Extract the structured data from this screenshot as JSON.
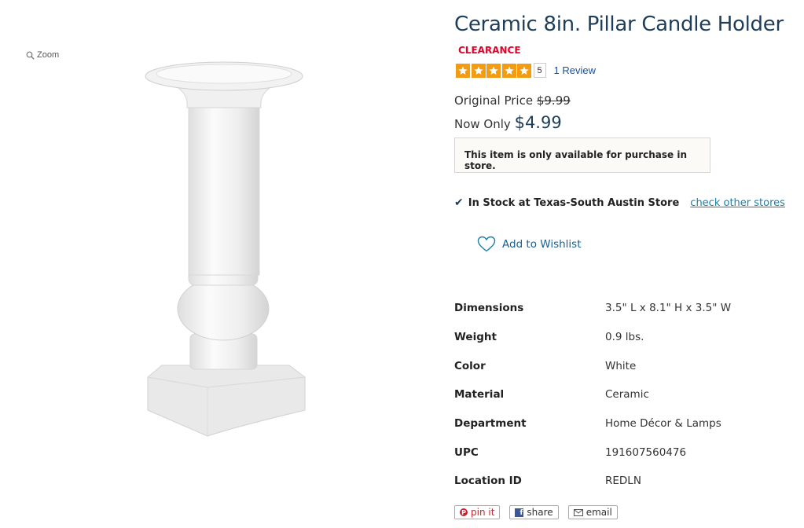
{
  "gallery": {
    "zoom_label": "Zoom"
  },
  "product": {
    "title": "Ceramic 8in. Pillar Candle Holder",
    "badge": "CLEARANCE",
    "rating": {
      "stars": 5,
      "value": "5",
      "review_link": "1 Review"
    },
    "original_price_label": "Original Price",
    "original_price": "$9.99",
    "now_label": "Now Only",
    "now_price": "$4.99",
    "store_note": "This item is only available for purchase in store.",
    "stock_text": "In Stock at Texas-South Austin Store",
    "check_stores": "check other stores",
    "wishlist_label": "Add to Wishlist"
  },
  "specs": [
    {
      "label": "Dimensions",
      "value": "3.5\" L x 8.1\" H x 3.5\" W"
    },
    {
      "label": "Weight",
      "value": "0.9 lbs."
    },
    {
      "label": "Color",
      "value": "White"
    },
    {
      "label": "Material",
      "value": "Ceramic"
    },
    {
      "label": "Department",
      "value": "Home Décor & Lamps"
    },
    {
      "label": "UPC",
      "value": "191607560476"
    },
    {
      "label": "Location ID",
      "value": "REDLN"
    }
  ],
  "share": {
    "pin": "pin it",
    "facebook": "share",
    "email": "email"
  },
  "colors": {
    "title": "#1e3d59",
    "clearance": "#e4002b",
    "star": "#f39c12",
    "link": "#1a7fa8"
  }
}
